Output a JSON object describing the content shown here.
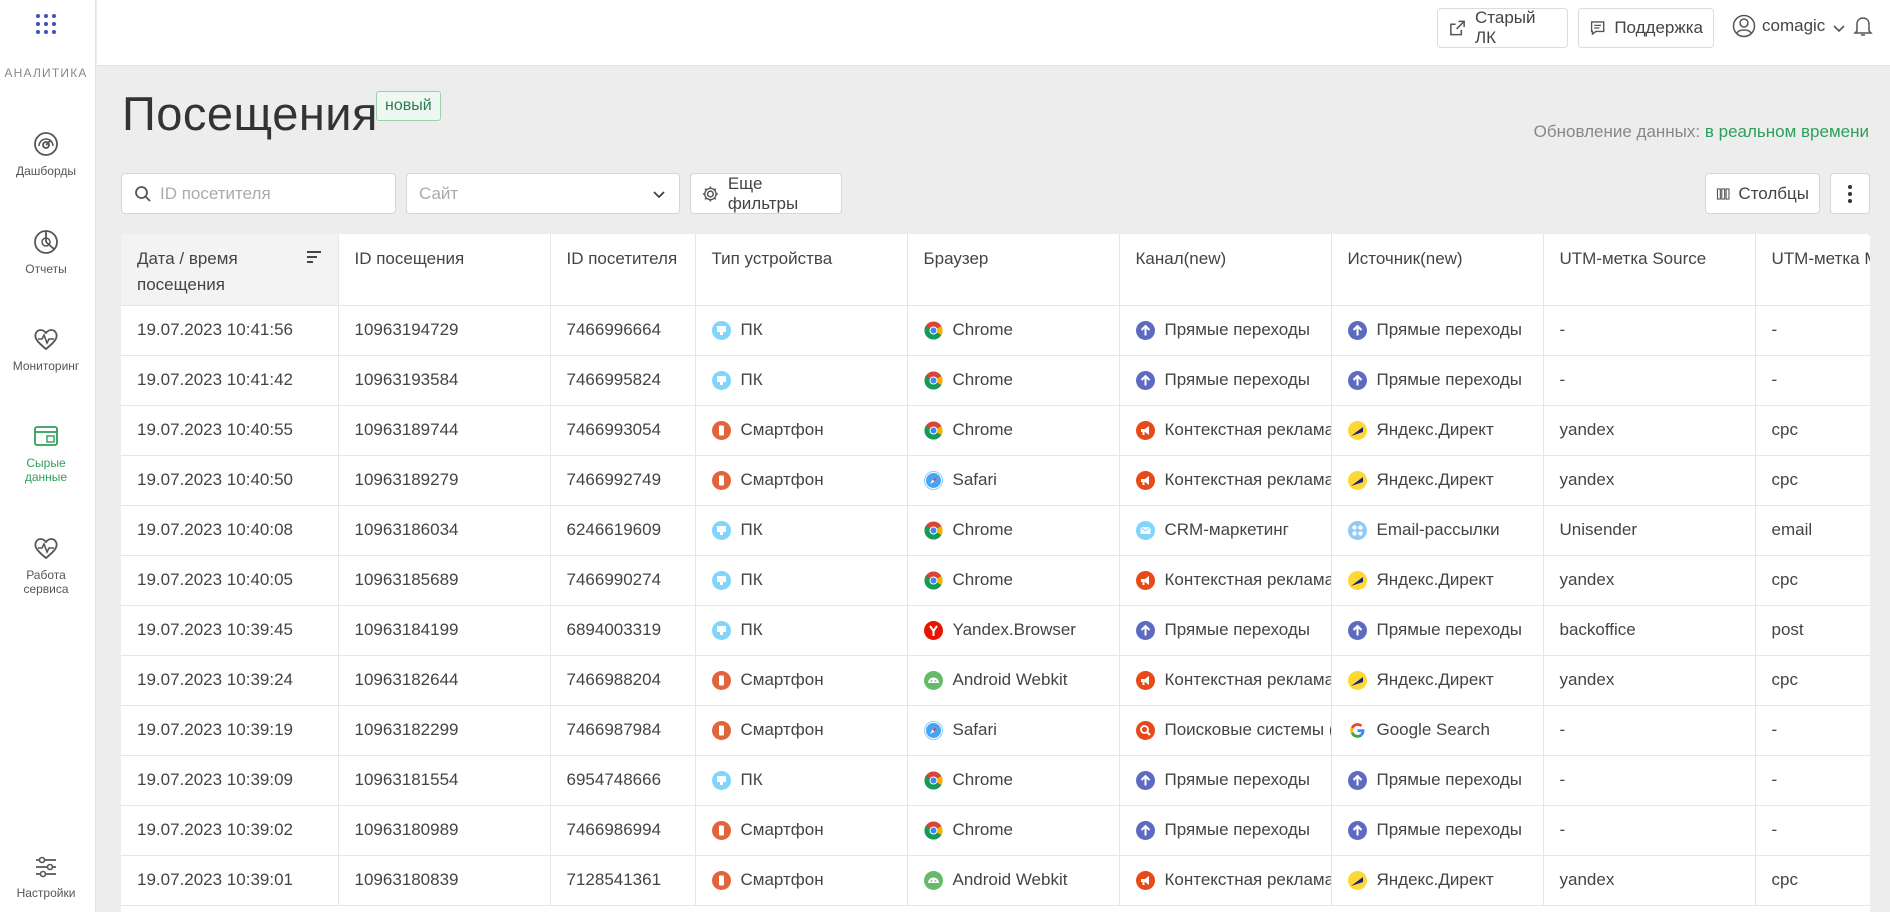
{
  "sidebar": {
    "brand": "АНАЛИТИКА",
    "items": [
      {
        "label": "Дашборды"
      },
      {
        "label": "Отчеты"
      },
      {
        "label": "Мониторинг"
      },
      {
        "label": "Сырые данные",
        "active": true
      },
      {
        "label": "Работа сервиса"
      },
      {
        "label": "Настройки"
      }
    ]
  },
  "topbar": {
    "old_cabinet": "Старый ЛК",
    "support": "Поддержка",
    "user": "comagic"
  },
  "header": {
    "title": "Посещения",
    "badge": "новый",
    "update_label": "Обновление данных:",
    "update_value": "в реальном времени"
  },
  "filters": {
    "search_placeholder": "ID посетителя",
    "site_placeholder": "Сайт",
    "more_filters": "Еще фильтры",
    "columns": "Столбцы"
  },
  "colors": {
    "accent": "#2e9f5a",
    "direct": "#5c6bc0",
    "context": "#e64a19",
    "device_pc": "#81d4fa",
    "device_phone": "#e0643c"
  },
  "table": {
    "columns": [
      "Дата / время посещения",
      "ID посещения",
      "ID посетителя",
      "Тип устройства",
      "Браузер",
      "Канал(new)",
      "Источник(new)",
      "UTM-метка Source",
      "UTM-метка Medium"
    ],
    "rows": [
      {
        "dt": "19.07.2023 10:41:56",
        "visit": "10963194729",
        "visitor": "7466996664",
        "device": "ПК",
        "device_icon": "pc-icon",
        "browser": "Chrome",
        "browser_icon": "chrome-icon",
        "channel": "Прямые переходы",
        "channel_icon": "direct-arrow-icon",
        "source": "Прямые переходы",
        "source_icon": "direct-arrow-icon",
        "utm_source": "-",
        "utm_medium": "-"
      },
      {
        "dt": "19.07.2023 10:41:42",
        "visit": "10963193584",
        "visitor": "7466995824",
        "device": "ПК",
        "device_icon": "pc-icon",
        "browser": "Chrome",
        "browser_icon": "chrome-icon",
        "channel": "Прямые переходы",
        "channel_icon": "direct-arrow-icon",
        "source": "Прямые переходы",
        "source_icon": "direct-arrow-icon",
        "utm_source": "-",
        "utm_medium": "-"
      },
      {
        "dt": "19.07.2023 10:40:55",
        "visit": "10963189744",
        "visitor": "7466993054",
        "device": "Смартфон",
        "device_icon": "smartphone-icon",
        "browser": "Chrome",
        "browser_icon": "chrome-icon",
        "channel": "Контекстная реклама",
        "channel_icon": "context-ads-icon",
        "source": "Яндекс.Директ",
        "source_icon": "yandex-direct-icon",
        "utm_source": "yandex",
        "utm_medium": "cpc"
      },
      {
        "dt": "19.07.2023 10:40:50",
        "visit": "10963189279",
        "visitor": "7466992749",
        "device": "Смартфон",
        "device_icon": "smartphone-icon",
        "browser": "Safari",
        "browser_icon": "safari-icon",
        "channel": "Контекстная реклама",
        "channel_icon": "context-ads-icon",
        "source": "Яндекс.Директ",
        "source_icon": "yandex-direct-icon",
        "utm_source": "yandex",
        "utm_medium": "cpc"
      },
      {
        "dt": "19.07.2023 10:40:08",
        "visit": "10963186034",
        "visitor": "6246619609",
        "device": "ПК",
        "device_icon": "pc-icon",
        "browser": "Chrome",
        "browser_icon": "chrome-icon",
        "channel": "CRM-маркетинг",
        "channel_icon": "email-icon",
        "source": "Email-рассылки",
        "source_icon": "email-newsletter-icon",
        "utm_source": "Unisender",
        "utm_medium": "email"
      },
      {
        "dt": "19.07.2023 10:40:05",
        "visit": "10963185689",
        "visitor": "7466990274",
        "device": "ПК",
        "device_icon": "pc-icon",
        "browser": "Chrome",
        "browser_icon": "chrome-icon",
        "channel": "Контекстная реклама",
        "channel_icon": "context-ads-icon",
        "source": "Яндекс.Директ",
        "source_icon": "yandex-direct-icon",
        "utm_source": "yandex",
        "utm_medium": "cpc"
      },
      {
        "dt": "19.07.2023 10:39:45",
        "visit": "10963184199",
        "visitor": "6894003319",
        "device": "ПК",
        "device_icon": "pc-icon",
        "browser": "Yandex.Browser",
        "browser_icon": "yandex-browser-icon",
        "channel": "Прямые переходы",
        "channel_icon": "direct-arrow-icon",
        "source": "Прямые переходы",
        "source_icon": "direct-arrow-icon",
        "utm_source": "backoffice",
        "utm_medium": "post"
      },
      {
        "dt": "19.07.2023 10:39:24",
        "visit": "10963182644",
        "visitor": "7466988204",
        "device": "Смартфон",
        "device_icon": "smartphone-icon",
        "browser": "Android Webkit",
        "browser_icon": "android-icon",
        "channel": "Контекстная реклама",
        "channel_icon": "context-ads-icon",
        "source": "Яндекс.Директ",
        "source_icon": "yandex-direct-icon",
        "utm_source": "yandex",
        "utm_medium": "cpc"
      },
      {
        "dt": "19.07.2023 10:39:19",
        "visit": "10963182299",
        "visitor": "7466987984",
        "device": "Смартфон",
        "device_icon": "smartphone-icon",
        "browser": "Safari",
        "browser_icon": "safari-icon",
        "channel": "Поисковые системы (",
        "channel_icon": "search-engines-icon",
        "source": "Google Search",
        "source_icon": "google-icon",
        "utm_source": "-",
        "utm_medium": "-"
      },
      {
        "dt": "19.07.2023 10:39:09",
        "visit": "10963181554",
        "visitor": "6954748666",
        "device": "ПК",
        "device_icon": "pc-icon",
        "browser": "Chrome",
        "browser_icon": "chrome-icon",
        "channel": "Прямые переходы",
        "channel_icon": "direct-arrow-icon",
        "source": "Прямые переходы",
        "source_icon": "direct-arrow-icon",
        "utm_source": "-",
        "utm_medium": "-"
      },
      {
        "dt": "19.07.2023 10:39:02",
        "visit": "10963180989",
        "visitor": "7466986994",
        "device": "Смартфон",
        "device_icon": "smartphone-icon",
        "browser": "Chrome",
        "browser_icon": "chrome-icon",
        "channel": "Прямые переходы",
        "channel_icon": "direct-arrow-icon",
        "source": "Прямые переходы",
        "source_icon": "direct-arrow-icon",
        "utm_source": "-",
        "utm_medium": "-"
      },
      {
        "dt": "19.07.2023 10:39:01",
        "visit": "10963180839",
        "visitor": "7128541361",
        "device": "Смартфон",
        "device_icon": "smartphone-icon",
        "browser": "Android Webkit",
        "browser_icon": "android-icon",
        "channel": "Контекстная реклама",
        "channel_icon": "context-ads-icon",
        "source": "Яндекс.Директ",
        "source_icon": "yandex-direct-icon",
        "utm_source": "yandex",
        "utm_medium": "cpc"
      }
    ]
  }
}
